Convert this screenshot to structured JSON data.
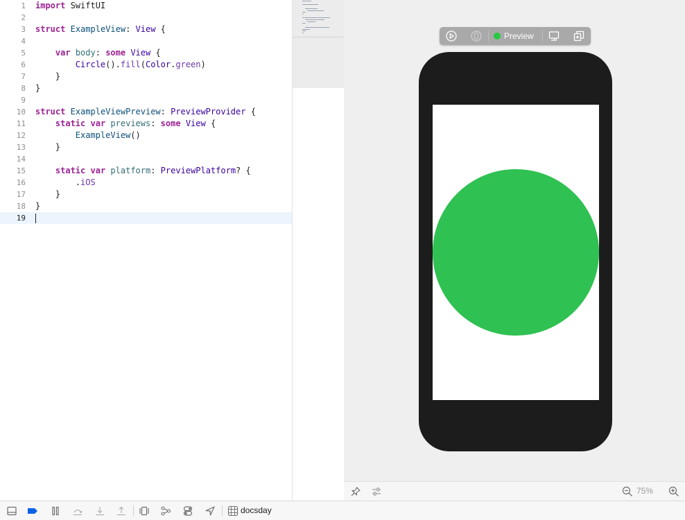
{
  "editor": {
    "lines": [
      {
        "n": "1",
        "tokens": [
          {
            "t": "import",
            "c": "kw"
          },
          {
            "t": " SwiftUI",
            "c": ""
          }
        ]
      },
      {
        "n": "2",
        "tokens": []
      },
      {
        "n": "3",
        "tokens": [
          {
            "t": "struct",
            "c": "kw"
          },
          {
            "t": " ",
            "c": ""
          },
          {
            "t": "ExampleView",
            "c": "td"
          },
          {
            "t": ": ",
            "c": ""
          },
          {
            "t": "View",
            "c": "ty"
          },
          {
            "t": " {",
            "c": ""
          }
        ]
      },
      {
        "n": "4",
        "tokens": []
      },
      {
        "n": "5",
        "tokens": [
          {
            "t": "    ",
            "c": ""
          },
          {
            "t": "var",
            "c": "kw"
          },
          {
            "t": " ",
            "c": ""
          },
          {
            "t": "body",
            "c": "fn"
          },
          {
            "t": ": ",
            "c": ""
          },
          {
            "t": "some",
            "c": "kw"
          },
          {
            "t": " ",
            "c": ""
          },
          {
            "t": "View",
            "c": "ty"
          },
          {
            "t": " {",
            "c": ""
          }
        ]
      },
      {
        "n": "6",
        "tokens": [
          {
            "t": "        ",
            "c": ""
          },
          {
            "t": "Circle",
            "c": "ty"
          },
          {
            "t": "().",
            "c": ""
          },
          {
            "t": "fill",
            "c": "fn2"
          },
          {
            "t": "(",
            "c": ""
          },
          {
            "t": "Color",
            "c": "ty"
          },
          {
            "t": ".",
            "c": ""
          },
          {
            "t": "green",
            "c": "fn2"
          },
          {
            "t": ")",
            "c": ""
          }
        ]
      },
      {
        "n": "7",
        "tokens": [
          {
            "t": "    }",
            "c": ""
          }
        ]
      },
      {
        "n": "8",
        "tokens": [
          {
            "t": "}",
            "c": ""
          }
        ]
      },
      {
        "n": "9",
        "tokens": []
      },
      {
        "n": "10",
        "tokens": [
          {
            "t": "struct",
            "c": "kw"
          },
          {
            "t": " ",
            "c": ""
          },
          {
            "t": "ExampleViewPreview",
            "c": "td"
          },
          {
            "t": ": ",
            "c": ""
          },
          {
            "t": "PreviewProvider",
            "c": "ty"
          },
          {
            "t": " {",
            "c": ""
          }
        ]
      },
      {
        "n": "11",
        "tokens": [
          {
            "t": "    ",
            "c": ""
          },
          {
            "t": "static",
            "c": "kw"
          },
          {
            "t": " ",
            "c": ""
          },
          {
            "t": "var",
            "c": "kw"
          },
          {
            "t": " ",
            "c": ""
          },
          {
            "t": "previews",
            "c": "fn"
          },
          {
            "t": ": ",
            "c": ""
          },
          {
            "t": "some",
            "c": "kw"
          },
          {
            "t": " ",
            "c": ""
          },
          {
            "t": "View",
            "c": "ty"
          },
          {
            "t": " {",
            "c": ""
          }
        ]
      },
      {
        "n": "12",
        "tokens": [
          {
            "t": "        ",
            "c": ""
          },
          {
            "t": "ExampleView",
            "c": "td"
          },
          {
            "t": "()",
            "c": ""
          }
        ]
      },
      {
        "n": "13",
        "tokens": [
          {
            "t": "    }",
            "c": ""
          }
        ]
      },
      {
        "n": "14",
        "tokens": []
      },
      {
        "n": "15",
        "tokens": [
          {
            "t": "    ",
            "c": ""
          },
          {
            "t": "static",
            "c": "kw"
          },
          {
            "t": " ",
            "c": ""
          },
          {
            "t": "var",
            "c": "kw"
          },
          {
            "t": " ",
            "c": ""
          },
          {
            "t": "platform",
            "c": "fn"
          },
          {
            "t": ": ",
            "c": ""
          },
          {
            "t": "PreviewPlatform",
            "c": "ty"
          },
          {
            "t": "? {",
            "c": ""
          }
        ]
      },
      {
        "n": "16",
        "tokens": [
          {
            "t": "        .",
            "c": ""
          },
          {
            "t": "iOS",
            "c": "fn2"
          }
        ]
      },
      {
        "n": "17",
        "tokens": [
          {
            "t": "    }",
            "c": ""
          }
        ]
      },
      {
        "n": "18",
        "tokens": [
          {
            "t": "}",
            "c": ""
          }
        ]
      },
      {
        "n": "19",
        "tokens": [],
        "current": true
      }
    ]
  },
  "canvas": {
    "toolbar": {
      "live_preview_icon": "play-circle-icon",
      "inspect_icon": "inspect-icon",
      "preview_label": "Preview",
      "status_color": "#28c840",
      "device_settings_icon": "device-settings-icon",
      "duplicate_icon": "duplicate-preview-icon"
    },
    "device": {
      "frame_color": "#1c1c1c",
      "circle_color": "#2fc152"
    },
    "bottom": {
      "pin_icon": "pin-icon",
      "adjust_icon": "sliders-icon",
      "zoom_out_icon": "zoom-out-icon",
      "zoom_level": "75%",
      "zoom_in_icon": "zoom-in-icon"
    }
  },
  "debug_bar": {
    "scheme_name": "docsday",
    "icons": [
      "hide-debug-area-icon",
      "breakpoints-icon",
      "pause-icon",
      "step-over-icon",
      "step-into-icon",
      "step-out-icon",
      "view-hierarchy-icon",
      "memory-graph-icon",
      "environment-overrides-icon",
      "simulate-location-icon",
      "scheme-icon"
    ]
  }
}
